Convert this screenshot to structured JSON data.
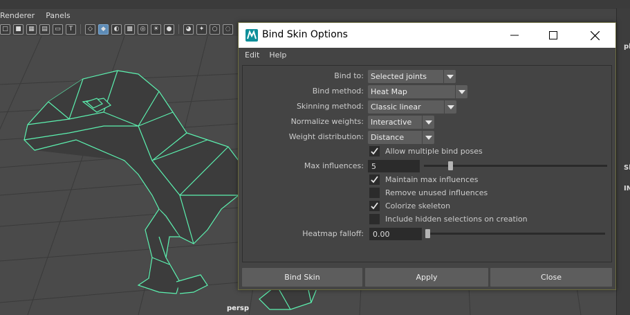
{
  "viewport": {
    "menus": [
      "Renderer",
      "Panels"
    ],
    "camera_label": "persp",
    "right_panel_texts": [
      "pl",
      "Sl",
      "IN"
    ]
  },
  "dialog": {
    "title": "Bind Skin Options",
    "menu": [
      "Edit",
      "Help"
    ],
    "fields": {
      "bind_to": {
        "label": "Bind to:",
        "value": "Selected joints"
      },
      "bind_method": {
        "label": "Bind method:",
        "value": "Heat Map"
      },
      "skinning_method": {
        "label": "Skinning method:",
        "value": "Classic linear"
      },
      "normalize_weights": {
        "label": "Normalize weights:",
        "value": "Interactive"
      },
      "weight_distribution": {
        "label": "Weight distribution:",
        "value": "Distance"
      },
      "max_influences": {
        "label": "Max influences:",
        "value": "5",
        "slider_fraction": 0.15
      },
      "heatmap_falloff": {
        "label": "Heatmap falloff:",
        "value": "0.00",
        "slider_fraction": 0.0
      }
    },
    "checkboxes": {
      "allow_multiple_bind_poses": {
        "label": "Allow multiple bind poses",
        "checked": true
      },
      "maintain_max_influences": {
        "label": "Maintain max influences",
        "checked": true
      },
      "remove_unused_influences": {
        "label": "Remove unused influences",
        "checked": false
      },
      "colorize_skeleton": {
        "label": "Colorize skeleton",
        "checked": true
      },
      "include_hidden_selections": {
        "label": "Include hidden selections on creation",
        "checked": false
      }
    },
    "buttons": {
      "bind_skin": "Bind Skin",
      "apply": "Apply",
      "close": "Close"
    }
  },
  "colors": {
    "wireframe": "#5cf2b0",
    "dialog_bg": "#444444",
    "field_bg": "#5d5d5d",
    "title_bar": "#ffffff"
  },
  "icons": [
    "minimize-icon",
    "maximize-icon",
    "close-icon",
    "maya-logo-icon",
    "checkmark-icon",
    "dropdown-arrow-icon"
  ]
}
